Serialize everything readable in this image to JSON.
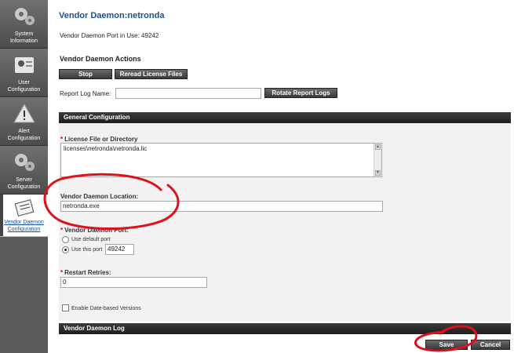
{
  "sidebar": {
    "items": [
      {
        "label_line1": "System",
        "label_line2": "Information",
        "icon": "gears-icon"
      },
      {
        "label_line1": "User",
        "label_line2": "Configuration",
        "icon": "id-card-icon"
      },
      {
        "label_line1": "Alert",
        "label_line2": "Configuration",
        "icon": "warning-icon"
      },
      {
        "label_line1": "Server",
        "label_line2": "Configuration",
        "icon": "gears-icon"
      },
      {
        "label_line1": "Vendor Daemon",
        "label_line2": "Configuration",
        "icon": "certificate-icon"
      }
    ]
  },
  "page": {
    "title": "Vendor Daemon:netronda",
    "port_in_use": "Vendor Daemon Port in Use: 49242"
  },
  "actions": {
    "title": "Vendor Daemon Actions",
    "stop_label": "Stop",
    "reread_label": "Reread License Files",
    "report_log_label": "Report Log Name:",
    "report_log_value": "",
    "rotate_label": "Rotate Report Logs"
  },
  "general": {
    "header": "General Configuration",
    "license_label": "License File or Directory",
    "license_value": "licenses\\netronda\\netronda.lic",
    "location_label": "Vendor Daemon Location:",
    "location_value": "netronda.exe",
    "port_label": "Vendor Daemon Port:",
    "default_port_label": "Use default port",
    "this_port_label": "Use this port",
    "port_value": "49242",
    "retries_label": "Restart Retries:",
    "retries_value": "0",
    "date_versions_label": "Enable Date-based Versions"
  },
  "log": {
    "header": "Vendor Daemon Log"
  },
  "footer": {
    "save_label": "Save",
    "cancel_label": "Cancel"
  },
  "colors": {
    "title": "#1f4e8c",
    "annotation": "#e0101a",
    "required": "#cc0000"
  }
}
